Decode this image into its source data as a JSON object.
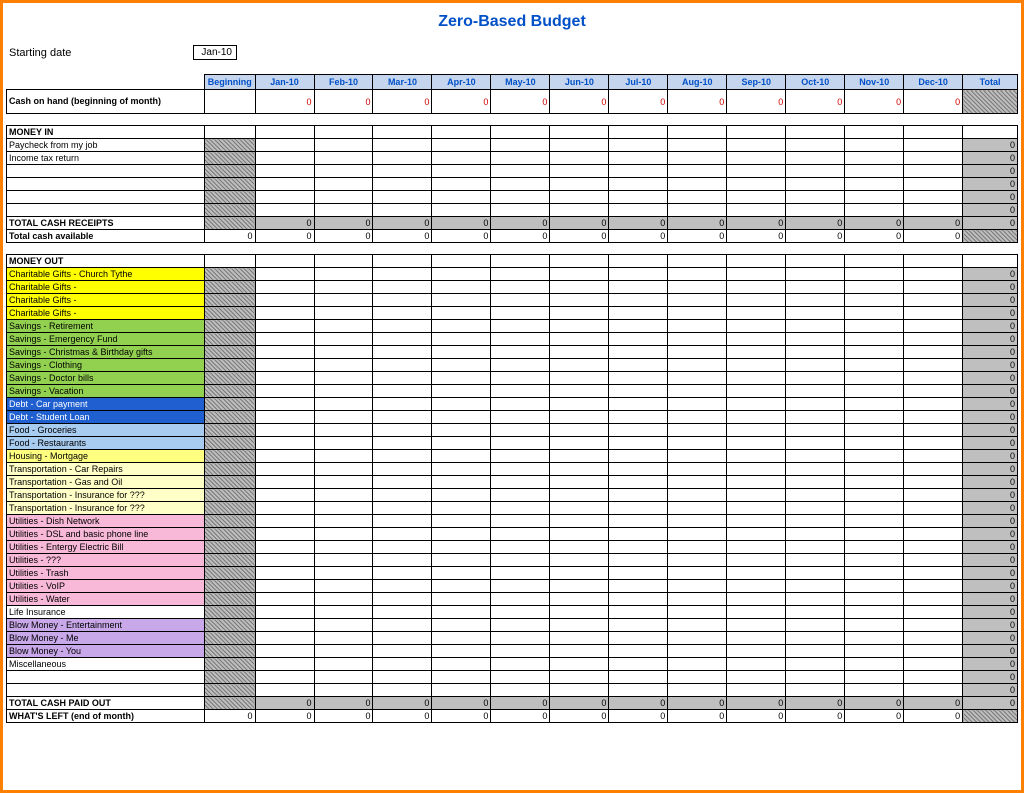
{
  "title": "Zero-Based Budget",
  "starting_label": "Starting date",
  "starting_value": "Jan-10",
  "headers": [
    "Beginning",
    "Jan-10",
    "Feb-10",
    "Mar-10",
    "Apr-10",
    "May-10",
    "Jun-10",
    "Jul-10",
    "Aug-10",
    "Sep-10",
    "Oct-10",
    "Nov-10",
    "Dec-10",
    "Total"
  ],
  "cash_on_hand_label": "Cash on hand (beginning of month)",
  "money_in_label": "MONEY IN",
  "money_in_rows": [
    "Paycheck from my job",
    "Income tax return",
    "",
    "",
    "",
    ""
  ],
  "total_cash_receipts": "TOTAL CASH RECEIPTS",
  "total_cash_available": "Total cash available",
  "money_out_label": "MONEY OUT",
  "money_out_rows": [
    {
      "label": "Charitable Gifts - Church Tythe",
      "color": "c-yellow"
    },
    {
      "label": "Charitable Gifts -",
      "color": "c-yellow"
    },
    {
      "label": "Charitable Gifts -",
      "color": "c-yellow"
    },
    {
      "label": "Charitable Gifts -",
      "color": "c-yellow"
    },
    {
      "label": "Savings - Retirement",
      "color": "c-green"
    },
    {
      "label": "Savings - Emergency Fund",
      "color": "c-green"
    },
    {
      "label": "Savings - Christmas & Birthday gifts",
      "color": "c-green"
    },
    {
      "label": "Savings - Clothing",
      "color": "c-green"
    },
    {
      "label": "Savings - Doctor bills",
      "color": "c-green"
    },
    {
      "label": "Savings - Vacation",
      "color": "c-green"
    },
    {
      "label": "Debt - Car payment",
      "color": "c-blue"
    },
    {
      "label": "Debt - Student Loan",
      "color": "c-blue"
    },
    {
      "label": "Food - Groceries",
      "color": "c-ltblue"
    },
    {
      "label": "Food - Restaurants",
      "color": "c-ltblue"
    },
    {
      "label": "Housing - Mortgage",
      "color": "c-ltyellow"
    },
    {
      "label": "Transportation - Car Repairs",
      "color": "c-paleyel"
    },
    {
      "label": "Transportation - Gas and Oil",
      "color": "c-paleyel"
    },
    {
      "label": "Transportation - Insurance for ???",
      "color": "c-paleyel"
    },
    {
      "label": "Transportation - Insurance for ???",
      "color": "c-paleyel"
    },
    {
      "label": "Utilities - Dish Network",
      "color": "c-pink"
    },
    {
      "label": "Utilities - DSL and basic phone line",
      "color": "c-pink"
    },
    {
      "label": "Utilities - Entergy Electric Bill",
      "color": "c-pink"
    },
    {
      "label": "Utilities - ???",
      "color": "c-pink"
    },
    {
      "label": "Utilities - Trash",
      "color": "c-pink"
    },
    {
      "label": "Utilities - VoIP",
      "color": "c-pink"
    },
    {
      "label": "Utilities - Water",
      "color": "c-pink"
    },
    {
      "label": "Life Insurance",
      "color": ""
    },
    {
      "label": "Blow Money - Entertainment",
      "color": "c-purple"
    },
    {
      "label": "Blow Money - Me",
      "color": "c-purple"
    },
    {
      "label": "Blow Money - You",
      "color": "c-purple"
    },
    {
      "label": "Miscellaneous",
      "color": ""
    },
    {
      "label": "",
      "color": ""
    },
    {
      "label": "",
      "color": ""
    }
  ],
  "total_cash_paid": "TOTAL CASH PAID OUT",
  "whats_left": "WHAT'S LEFT (end of month)",
  "zero": "0"
}
